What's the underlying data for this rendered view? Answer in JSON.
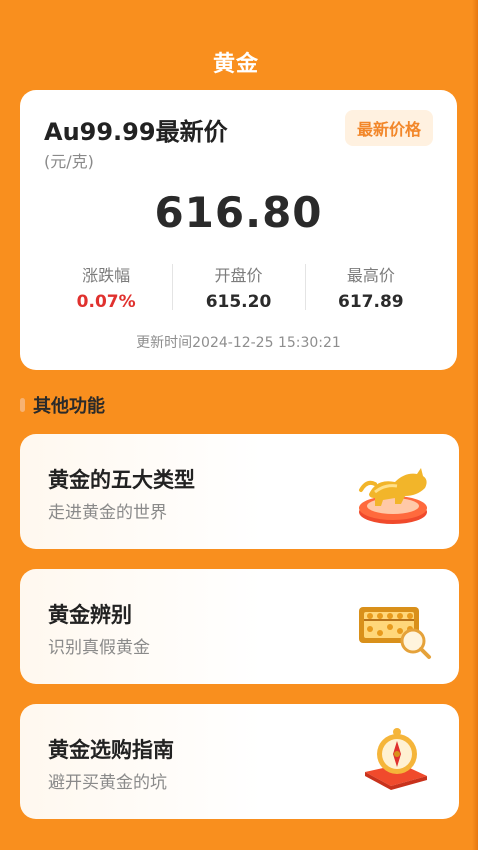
{
  "header": {
    "title": "黄金"
  },
  "price_card": {
    "title": "Au99.99最新价",
    "unit": "(元/克)",
    "badge": "最新价格",
    "price": "616.80",
    "stats": [
      {
        "label": "涨跌幅",
        "value": "0.07%",
        "color": "#E0312E"
      },
      {
        "label": "开盘价",
        "value": "615.20"
      },
      {
        "label": "最高价",
        "value": "617.89"
      }
    ],
    "updated": "更新时间2024-12-25 15:30:21"
  },
  "section": {
    "title": "其他功能"
  },
  "features": [
    {
      "title": "黄金的五大类型",
      "subtitle": "走进黄金的世界",
      "icon": "gold-bull-icon"
    },
    {
      "title": "黄金辨别",
      "subtitle": "识别真假黄金",
      "icon": "abacus-magnifier-icon"
    },
    {
      "title": "黄金选购指南",
      "subtitle": "避开买黄金的坑",
      "icon": "compass-book-icon"
    }
  ],
  "colors": {
    "background": "#F98F1E",
    "accent": "#F2872A",
    "up": "#E0312E"
  }
}
